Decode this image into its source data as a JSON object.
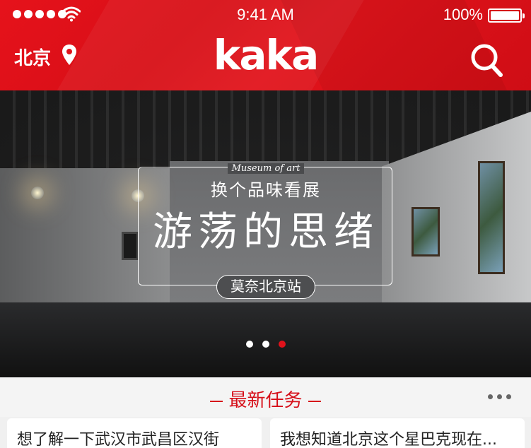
{
  "status_bar": {
    "time": "9:41 AM",
    "battery": "100%",
    "signal_dots": 5
  },
  "header": {
    "city": "北京",
    "logo": "kaka",
    "location_icon": "map-pin-icon",
    "search_icon": "search-icon"
  },
  "banner": {
    "museum_label": "Museum of art",
    "subtitle": "换个品味看展",
    "headline": "游荡的思绪",
    "station": "莫奈北京站",
    "carousel_total": 3,
    "carousel_active_index": 3
  },
  "section": {
    "title": "最新任务",
    "more_icon": "more-dots-icon"
  },
  "tasks": [
    {
      "text": "想了解一下武汉市武昌区汉街"
    },
    {
      "text": "我想知道北京这个星巴克现在..."
    }
  ],
  "colors": {
    "brand_red": "#e0121b",
    "section_red": "#d6101a"
  }
}
